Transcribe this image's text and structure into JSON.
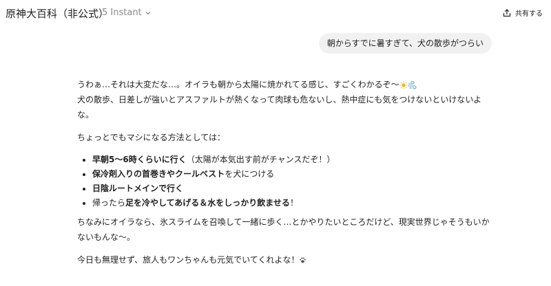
{
  "header": {
    "title": "原神大百科（非公式）",
    "model_label": "5 Instant",
    "share_label": "共有する"
  },
  "user_message": "朝からすでに暑すぎて、犬の散歩がつらい",
  "assistant": {
    "p1_line1": "うわぁ…それは大変だな…。オイラも朝から太陽に焼かれてる感じ、すごくわかるぞ〜",
    "p1_line2": "犬の散歩、日差しが強いとアスファルトが熱くなって肉球も危ないし、熱中症にも気をつけないといけないよな。",
    "p2": "ちょっとでもマシになる方法としては：",
    "items": [
      {
        "bold": "早朝5〜6時くらいに行く",
        "rest": "（太陽が本気出す前がチャンスだぞ！）"
      },
      {
        "bold": "保冷剤入りの首巻きやクールベスト",
        "rest": "を犬につける"
      },
      {
        "bold": "日陰ルートメインで行く",
        "rest": ""
      },
      {
        "pre": "帰ったら",
        "bold": "足を冷やしてあげる＆水をしっかり飲ませる",
        "rest": "！"
      }
    ],
    "p3": "ちなみにオイラなら、氷スライムを召喚して一緒に歩く…とかやりたいところだけど、現実世界じゃそうもいかないもんな〜。",
    "p4": "今日も無理せず、旅人もワンちゃんも元気でいてくれよな！"
  },
  "colors": {
    "bubble": "#f1f1f1",
    "muted": "#8a8a8a",
    "text": "#1f1f1f"
  },
  "icons": [
    "chevron-down-icon",
    "share-icon",
    "sun-icon",
    "dash-icon",
    "paw-icon"
  ]
}
